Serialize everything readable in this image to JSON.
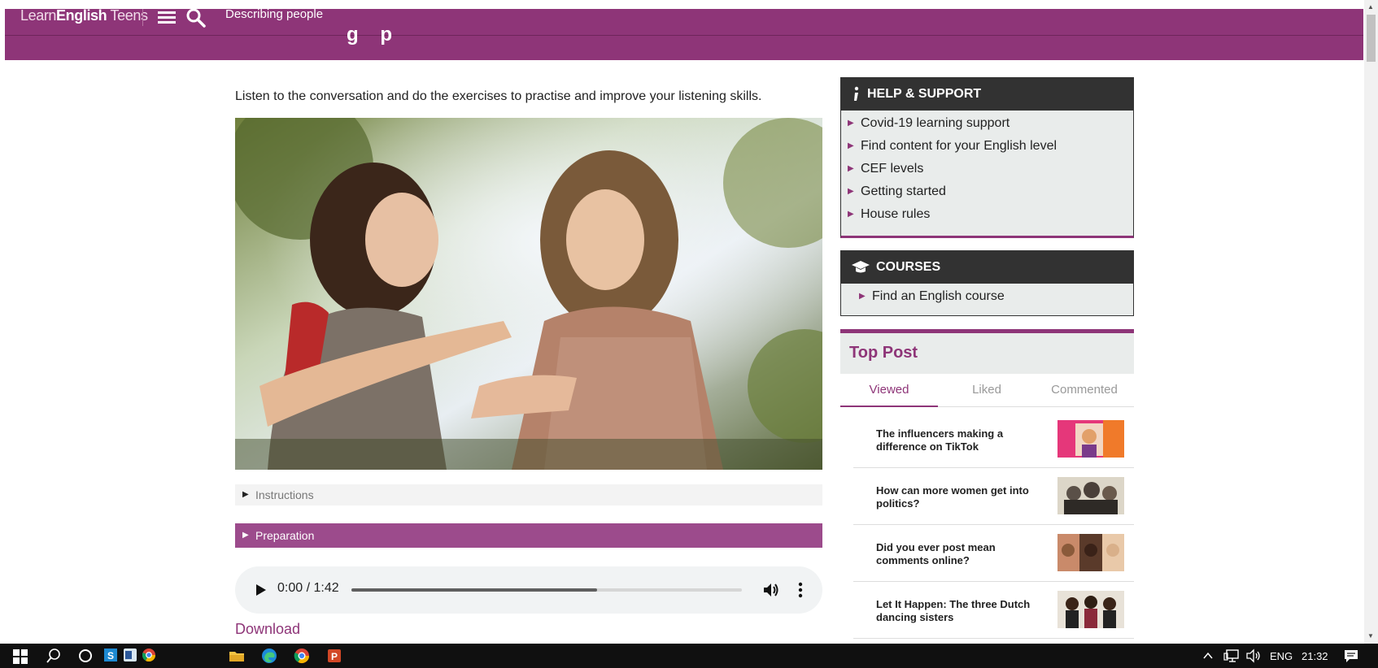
{
  "header": {
    "logo_light": "Learn",
    "logo_bold": "English",
    "logo_tail": " Teens",
    "breadcrumb": "Describing people",
    "page_title_partial": "g p"
  },
  "main": {
    "intro": "Listen to the conversation and do the exercises to practise and improve your listening skills.",
    "accordions": [
      "Instructions",
      "Preparation"
    ],
    "audio": {
      "time": "0:00 / 1:42",
      "progress": 0.63
    },
    "download": "Download"
  },
  "sidebar": {
    "help": {
      "title": "HELP & SUPPORT",
      "items": [
        "Covid-19 learning support",
        "Find content for your English level",
        "CEF levels",
        "Getting started",
        "House rules"
      ]
    },
    "courses": {
      "title": "COURSES",
      "items": [
        "Find an English course"
      ]
    },
    "top_post": {
      "title": "Top Post",
      "tabs": [
        "Viewed",
        "Liked",
        "Commented"
      ],
      "active_tab": "Viewed",
      "posts": [
        {
          "line1": "The influencers making a",
          "line2": "difference on TikTok"
        },
        {
          "line1": "How can more women get into",
          "line2": "politics?"
        },
        {
          "line1": "Did you ever post mean",
          "line2": "comments online?"
        },
        {
          "line1": "Let It Happen: The three Dutch",
          "line2": "dancing sisters"
        }
      ]
    }
  },
  "taskbar": {
    "language": "ENG",
    "clock": "21:32"
  },
  "colors": {
    "brand_purple": "#8e3578",
    "accordion_purple": "#9c4b8c",
    "box_header": "#323232",
    "box_body": "#e9eceb"
  }
}
